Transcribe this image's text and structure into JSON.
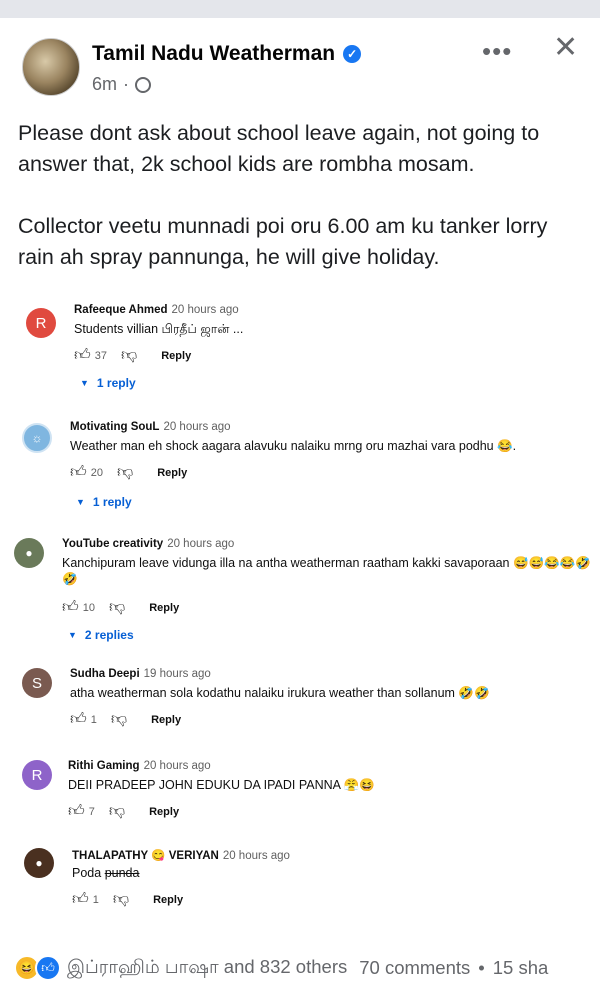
{
  "post": {
    "author": "Tamil Nadu Weatherman",
    "time": "6m",
    "dot": "·",
    "paragraphs": [
      "Please dont ask about school leave again, not going to answer that, 2k school kids are rombha mosam.",
      "Collector veetu munnadi poi oru 6.00 am ku tanker lorry rain ah spray pannunga, he will give holiday."
    ],
    "more_label": "•••",
    "close_label": "✕"
  },
  "comments": [
    {
      "avatar_letter": "R",
      "avatar_color": "#e04a3f",
      "name": "Rafeeque Ahmed",
      "time": "20 hours ago",
      "text": "Students villian பிரதீப் ஜான் ...",
      "likes": "37",
      "reply_label": "Reply",
      "replies": "1 reply"
    },
    {
      "avatar_letter": "",
      "avatar_color": "#7fb6e0",
      "name": "Motivating SouL",
      "time": "20 hours ago",
      "text": "Weather man eh shock aagara alavuku nalaiku mrng oru mazhai vara podhu 😂.",
      "likes": "20",
      "reply_label": "Reply",
      "replies": "1 reply"
    },
    {
      "avatar_letter": "",
      "avatar_color": "#6a7a5a",
      "name": "YouTube creativity",
      "time": "20 hours ago",
      "text": "Kanchipuram leave vidunga illa na antha weatherman raatham kakki savaporaan 😅😅😂😂🤣",
      "text2": "🤣",
      "likes": "10",
      "reply_label": "Reply",
      "replies": "2 replies"
    },
    {
      "avatar_letter": "S",
      "avatar_color": "#7a5a50",
      "name": "Sudha Deepi",
      "time": "19 hours ago",
      "text": "atha weatherman sola kodathu nalaiku irukura weather than sollanum 🤣🤣",
      "likes": "1",
      "reply_label": "Reply"
    },
    {
      "avatar_letter": "R",
      "avatar_color": "#8e63c9",
      "name": "Rithi Gaming",
      "time": "20 hours ago",
      "text": "DEII PRADEEP JOHN EDUKU DA IPADI PANNA 😤😆",
      "likes": "7",
      "reply_label": "Reply"
    },
    {
      "avatar_letter": "",
      "avatar_color": "#4a3020",
      "name": "THALAPATHY 😋 VERIYAN",
      "time": "20 hours ago",
      "text": "Poda",
      "text_struck": "punda",
      "likes": "1",
      "reply_label": "Reply"
    }
  ],
  "footer": {
    "reactions_text": "இப்ராஹிம் பாஷா and 832 others",
    "comments": "70 comments",
    "bullet": "•",
    "shares": "15 sha"
  }
}
